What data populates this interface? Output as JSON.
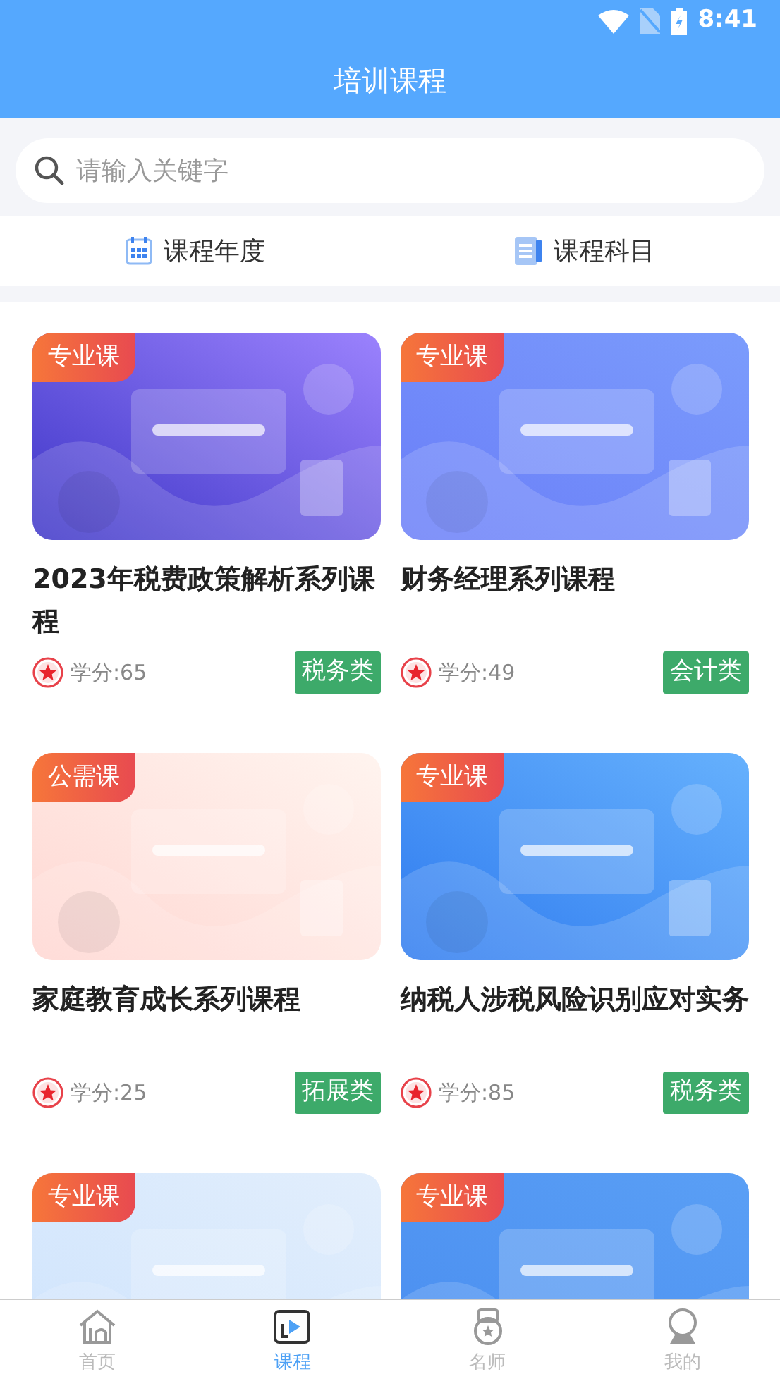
{
  "status_bar": {
    "time": "8:41"
  },
  "header": {
    "title": "培训课程"
  },
  "search": {
    "placeholder": "请输入关键字"
  },
  "filters": [
    {
      "label": "课程年度",
      "kind": "calendar"
    },
    {
      "label": "课程科目",
      "kind": "list"
    }
  ],
  "courses": [
    {
      "badge": "专业课",
      "title": "2023年税费政策解析系列课程",
      "credit": "学分:65",
      "category": "税务类",
      "kind": "picture"
    },
    {
      "badge": "专业课",
      "title": "财务经理系列课程",
      "credit": "学分:49",
      "category": "会计类",
      "kind": "picture"
    },
    {
      "badge": "公需课",
      "title": "家庭教育成长系列课程",
      "credit": "学分:25",
      "category": "拓展类",
      "kind": "picture"
    },
    {
      "badge": "专业课",
      "title": "纳税人涉税风险识别应对实务",
      "credit": "学分:85",
      "category": "税务类",
      "kind": "picture"
    },
    {
      "badge": "专业课",
      "kind": "picture"
    },
    {
      "badge": "专业课",
      "kind": "picture"
    }
  ],
  "tab_bar": [
    {
      "label": "首页",
      "kind": "home",
      "selected": false
    },
    {
      "label": "课程",
      "kind": "play",
      "selected": true
    },
    {
      "label": "名师",
      "kind": "medal",
      "selected": false
    },
    {
      "label": "我的",
      "kind": "user",
      "selected": false
    }
  ]
}
